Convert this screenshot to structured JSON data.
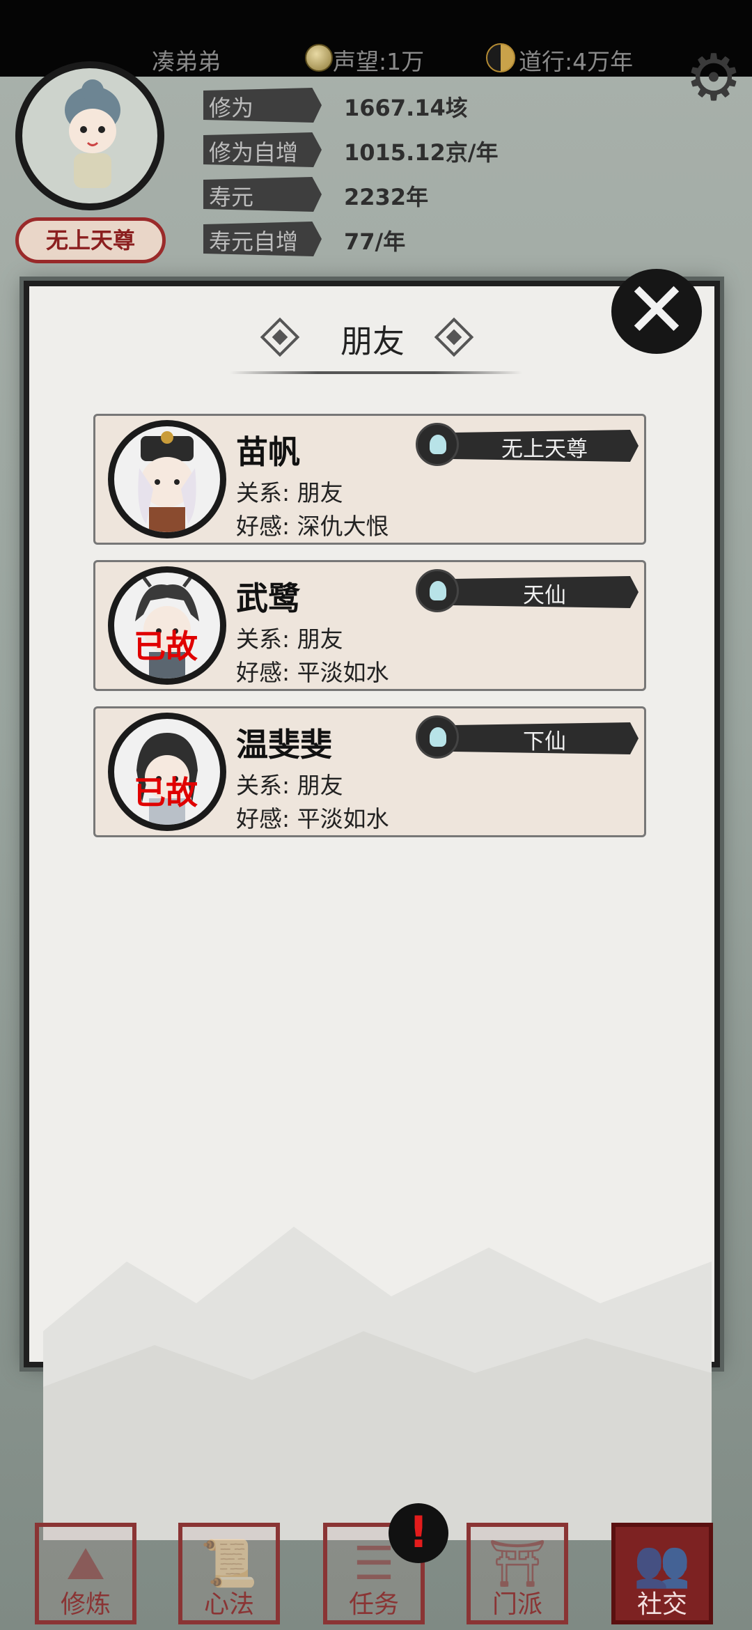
{
  "topbar": {
    "player_name": "凑弟弟",
    "reputation": "声望:1万",
    "dao_practice": "道行:4万年"
  },
  "profile": {
    "rank_badge": "无上天尊",
    "stats": [
      {
        "label": "修为",
        "value": "1667.14垓"
      },
      {
        "label": "修为自增",
        "value": "1015.12京/年"
      },
      {
        "label": "寿元",
        "value": "2232年"
      },
      {
        "label": "寿元自增",
        "value": "77/年"
      }
    ]
  },
  "dialog": {
    "title": "朋友",
    "friends": [
      {
        "name": "苗帆",
        "relation": "关系:  朋友",
        "affinity": "好感:  深仇大恨",
        "realm": "无上天尊",
        "deceased": ""
      },
      {
        "name": "武鹭",
        "relation": "关系:  朋友",
        "affinity": "好感:  平淡如水",
        "realm": "天仙",
        "deceased": "已故"
      },
      {
        "name": "温斐斐",
        "relation": "关系:  朋友",
        "affinity": "好感:  平淡如水",
        "realm": "下仙",
        "deceased": "已故"
      }
    ]
  },
  "tabs": [
    {
      "label": "修炼",
      "icon": "cultivate-icon"
    },
    {
      "label": "心法",
      "icon": "scroll-icon"
    },
    {
      "label": "任务",
      "icon": "task-icon"
    },
    {
      "label": "门派",
      "icon": "sect-icon"
    },
    {
      "label": "社交",
      "icon": "social-icon"
    }
  ],
  "alert": "!",
  "colors": {
    "dead_mark": "#e00000",
    "tab_active": "#7d2222"
  }
}
